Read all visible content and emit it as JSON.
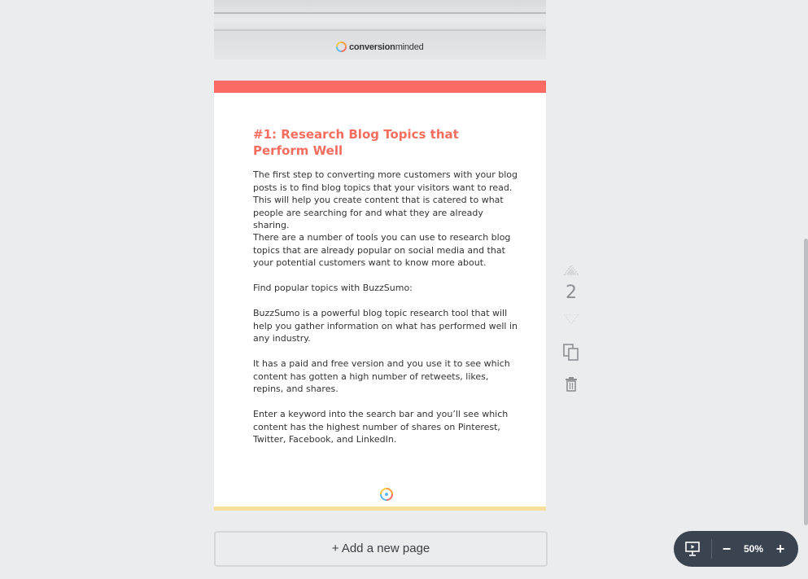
{
  "previous_page": {
    "brand_bold": "conversion",
    "brand_light": "minded"
  },
  "page": {
    "title": "#1: Research Blog Topics that Perform Well",
    "paragraphs": [
      "The first step to converting more customers with your blog posts is to find blog topics that your visitors want to read. This will help you create content that is catered to what people are searching for and what they are already sharing.",
      "There are a number of tools you can use to research blog topics that are already popular on social media and that your potential customers want to know more about.",
      "Find popular topics with BuzzSumo:",
      "BuzzSumo is a powerful blog topic research tool that will help you gather information on what has performed well in any industry.",
      "It has a paid and free version and you use it to see which content has gotten a high number of retweets, likes, repins, and shares.",
      "Enter a keyword into the search bar and you’ll see which content has the highest number of shares on Pinterest, Twitter, Facebook, and LinkedIn."
    ],
    "colors": {
      "top_bar": "#fb6b64",
      "bottom_bar": "#f8df9c",
      "title": "#f56d5f"
    }
  },
  "page_controls": {
    "page_number": "2",
    "icons": [
      "move-up-icon",
      "move-down-icon",
      "duplicate-icon",
      "trash-icon"
    ]
  },
  "add_page": {
    "label": "+ Add a new page"
  },
  "zoom": {
    "level": "50%",
    "minus": "−",
    "plus": "+",
    "icons": [
      "present-icon"
    ]
  }
}
